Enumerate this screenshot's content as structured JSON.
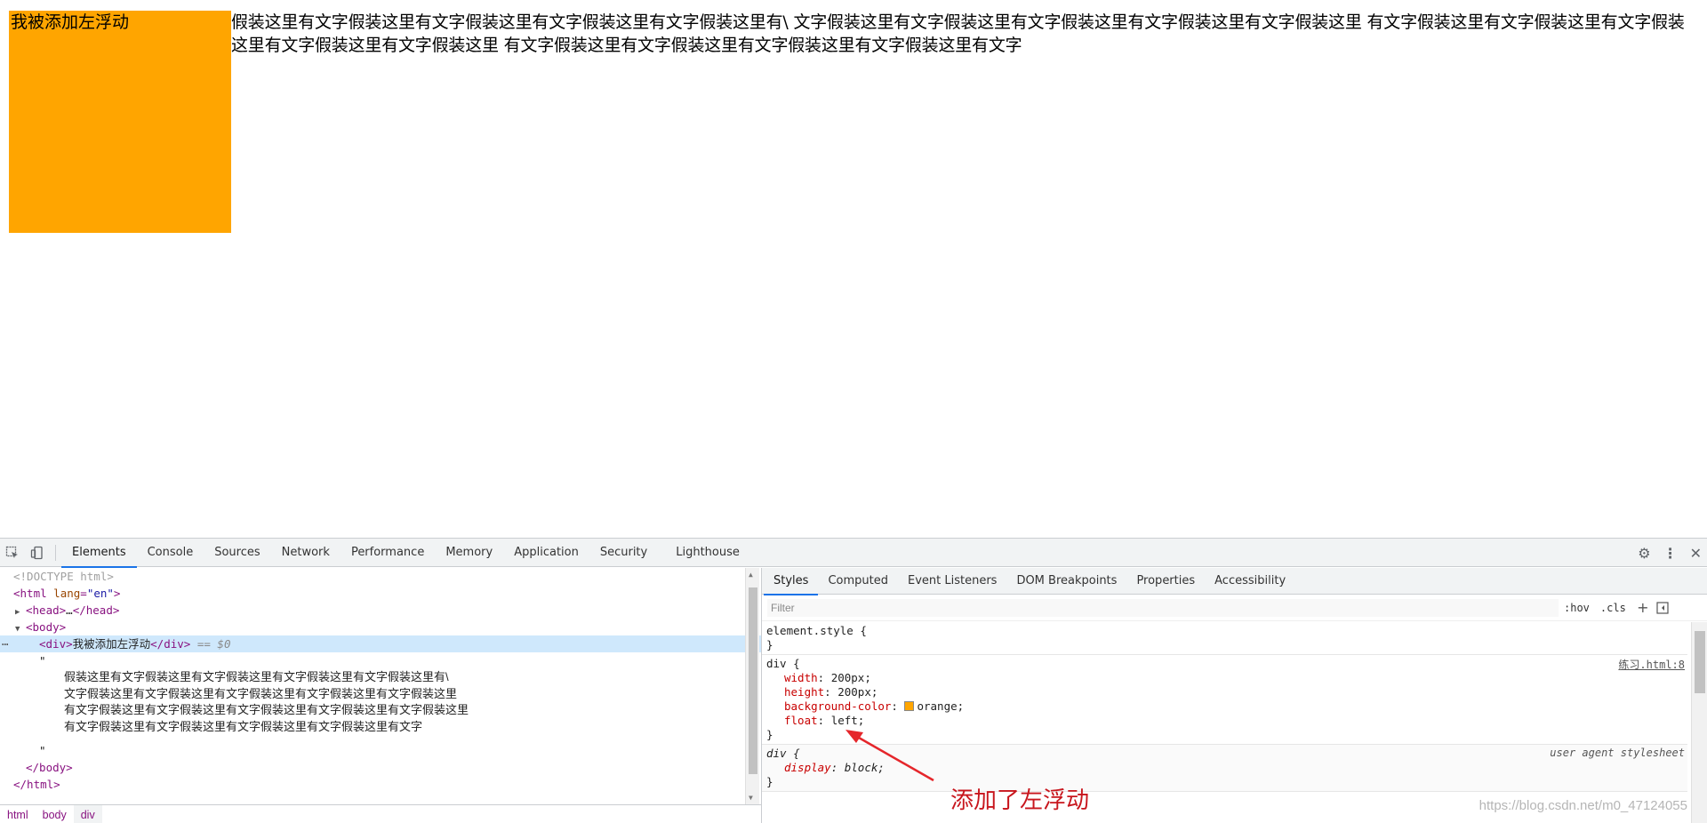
{
  "page": {
    "float_box_text": "我被添加左浮动",
    "paragraph": "假装这里有文字假装这里有文字假装这里有文字假装这里有文字假装这里有\\ 文字假装这里有文字假装这里有文字假装这里有文字假装这里有文字假装这里 有文字假装这里有文字假装这里有文字假装这里有文字假装这里有文字假装这里 有文字假装这里有文字假装这里有文字假装这里有文字假装这里有文字",
    "float_box_color": "#ffa500"
  },
  "devtools": {
    "main_tabs": [
      "Elements",
      "Console",
      "Sources",
      "Network",
      "Performance",
      "Memory",
      "Application",
      "Security",
      "Lighthouse"
    ],
    "active_tab": "Elements",
    "elements": {
      "doctype": "<!DOCTYPE html>",
      "html_open_tag": "html",
      "html_attr_name": "lang",
      "html_attr_value": "\"en\"",
      "head_collapsed": "…",
      "body_tag": "body",
      "div_text": "我被添加左浮动",
      "selected_marker": "== $0",
      "quote": "\"",
      "text_lines": [
        "假装这里有文字假装这里有文字假装这里有文字假装这里有文字假装这里有\\",
        "文字假装这里有文字假装这里有文字假装这里有文字假装这里有文字假装这里",
        "有文字假装这里有文字假装这里有文字假装这里有文字假装这里有文字假装这里",
        "有文字假装这里有文字假装这里有文字假装这里有文字假装这里有文字"
      ],
      "body_close": "</body>",
      "html_close": "</html>"
    },
    "breadcrumbs": [
      "html",
      "body",
      "div"
    ],
    "styles_tabs": [
      "Styles",
      "Computed",
      "Event Listeners",
      "DOM Breakpoints",
      "Properties",
      "Accessibility"
    ],
    "styles_active_tab": "Styles",
    "filter_placeholder": "Filter",
    "hov_label": ":hov",
    "cls_label": ".cls",
    "rules": {
      "element_style_selector": "element.style {",
      "close_brace": "}",
      "div_selector": "div {",
      "div_source": "练习.html:8",
      "div_props": [
        {
          "name": "width",
          "value": "200px;"
        },
        {
          "name": "height",
          "value": "200px;"
        },
        {
          "name": "background-color",
          "value": "orange;"
        },
        {
          "name": "float",
          "value": "left;"
        }
      ],
      "ua_selector": "div {",
      "ua_source": "user agent stylesheet",
      "ua_prop_name": "display",
      "ua_prop_value": "block;"
    }
  },
  "annotation": {
    "text": "添加了左浮动",
    "color": "#c8161d"
  },
  "watermark": "https://blog.csdn.net/m0_47124055"
}
